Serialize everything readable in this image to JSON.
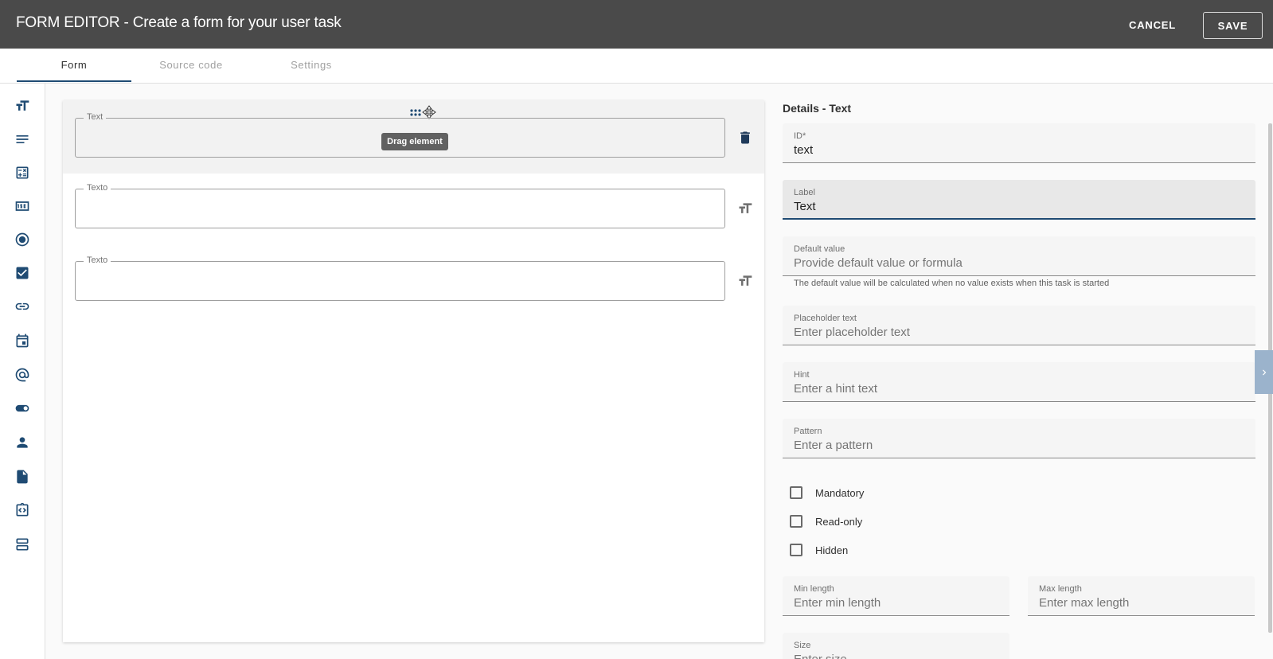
{
  "header": {
    "title": "FORM EDITOR - Create a form for your user task",
    "cancel_label": "CANCEL",
    "save_label": "SAVE"
  },
  "tabs": [
    {
      "label": "Form",
      "active": true
    },
    {
      "label": "Source code",
      "active": false
    },
    {
      "label": "Settings",
      "active": false
    }
  ],
  "toolbar": {
    "icons": [
      "text-field-icon",
      "textarea-icon",
      "calculation-icon",
      "number-icon",
      "radio-icon",
      "checkbox-icon",
      "link-icon",
      "date-icon",
      "email-icon",
      "toggle-icon",
      "user-icon",
      "file-icon",
      "code-icon",
      "section-icon"
    ]
  },
  "canvas": {
    "fields": [
      {
        "label": "Text",
        "selected": true
      },
      {
        "label": "Texto",
        "selected": false
      },
      {
        "label": "Texto",
        "selected": false
      }
    ],
    "tooltip": "Drag element"
  },
  "details": {
    "title": "Details - Text",
    "id": {
      "label": "ID*",
      "value": "text"
    },
    "label": {
      "label": "Label",
      "value": "Text"
    },
    "default_value": {
      "label": "Default value",
      "placeholder": "Provide default value or formula",
      "hint": "The default value will be calculated when no value exists when this task is started"
    },
    "placeholder_text": {
      "label": "Placeholder text",
      "placeholder": "Enter placeholder text"
    },
    "hint": {
      "label": "Hint",
      "placeholder": "Enter a hint text"
    },
    "pattern": {
      "label": "Pattern",
      "placeholder": "Enter a pattern"
    },
    "checkboxes": [
      {
        "label": "Mandatory",
        "checked": false
      },
      {
        "label": "Read-only",
        "checked": false
      },
      {
        "label": "Hidden",
        "checked": false
      }
    ],
    "min_length": {
      "label": "Min length",
      "placeholder": "Enter min length"
    },
    "max_length": {
      "label": "Max length",
      "placeholder": "Enter max length"
    },
    "size": {
      "label": "Size",
      "placeholder": "Enter size"
    }
  },
  "colors": {
    "header_bg": "#4a4a4a",
    "accent": "#1f4b73"
  }
}
